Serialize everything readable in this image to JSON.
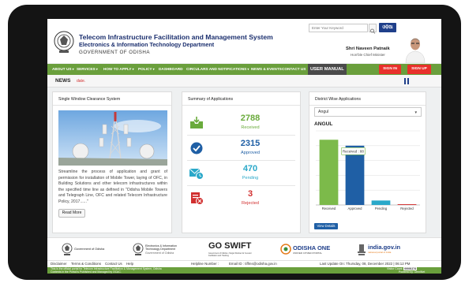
{
  "header": {
    "org_title": "Telecom Infrastructure Facilitation and Management System",
    "dept": "Electronics & Information Technology Department",
    "gov": "GOVERNMENT OF ODISHA",
    "search_placeholder": "Enter Your Keyword",
    "lang_button": "ଓଡ଼ିଆ",
    "cm_name": "Shri Naveen Patnaik",
    "cm_title": "Hon'ble Chief Minister"
  },
  "nav": {
    "items": [
      "ABOUT US",
      "SERVICES",
      "HOW TO APPLY",
      "POLICY",
      "DASHBOARD",
      "CIRCULARS AND NOTIFICATIONS",
      "NEWS & EVENTS",
      "CONTACT US",
      "USER MANUAL"
    ],
    "signin": "SIGN IN",
    "signup": "SIGN UP"
  },
  "news": {
    "label": "NEWS",
    "text": "date."
  },
  "swc": {
    "title": "Single Window Clearance System",
    "text": "Streamline the process of application and grant of permission for installation of Mobile Tower, laying of OFC, in Building Solutions and other telecom infrastructures within the specified time line as defined in \"Odisha Mobile Towers and Telegraph Line, OFC and related Telecom Infrastructure Policy, 2017......\"",
    "read_more": "Read More"
  },
  "summary": {
    "title": "Summary of Applications",
    "rows": [
      {
        "value": "2788",
        "label": "Received",
        "color": "#6aab3c",
        "icon": "inbox-arrow-icon"
      },
      {
        "value": "2315",
        "label": "Approved",
        "color": "#1f5fa5",
        "icon": "check-badge-icon"
      },
      {
        "value": "470",
        "label": "Pending",
        "color": "#2aa8c9",
        "icon": "pending-mail-icon"
      },
      {
        "value": "3",
        "label": "Rejected",
        "color": "#d12f2f",
        "icon": "rejected-document-icon"
      }
    ]
  },
  "district": {
    "title": "District Wise Applications",
    "selected": "Angul",
    "heading": "ANGUL",
    "tooltip": "Received : 88",
    "view_details": "View Details"
  },
  "chart_data": {
    "type": "bar",
    "categories": [
      "Received",
      "Approved",
      "Pending",
      "Rejected"
    ],
    "values": [
      88,
      80,
      6,
      1
    ],
    "colors": [
      "#7cba4a",
      "#1f5fa5",
      "#2aa8c9",
      "#d12f2f"
    ],
    "ylim": [
      0,
      100
    ],
    "grid": true
  },
  "logos": {
    "odisha": "Government of Odisha",
    "eit_line1": "Electronics & Information",
    "eit_line2": "Technology Department",
    "eit_line3": "Government of Odisha",
    "goswift": "GO SWIFT",
    "goswift_sub": "Government of Odisha • Single Window for Investor Facilitation and Tracking",
    "odisha_one": "ODISHA ONE",
    "odisha_one_sub": "UNIFIED CITIZEN PORTAL",
    "india_gov": "india.gov.in",
    "india_gov_sub": "national portal of india"
  },
  "footer": {
    "links": [
      "Disclaimer",
      "Terms & Conditions",
      "Contact Us",
      "Help"
    ],
    "helpline": "Helpline Number :",
    "email": "Email ID : tiffms@odisha.gov.in",
    "last_update": "Last Update On: Thursday, 08, December 2022 | 06:12 PM",
    "line1": "This is the official portal for Telecom Infrastructure Facilitation & Management System, Odisha",
    "line2": "Contents in the Portal is Published and Managed by OCAC.",
    "visitor_label": "Visitor Count:",
    "visitor_count": "00001174",
    "powered": "Powered by: OmniNet"
  }
}
